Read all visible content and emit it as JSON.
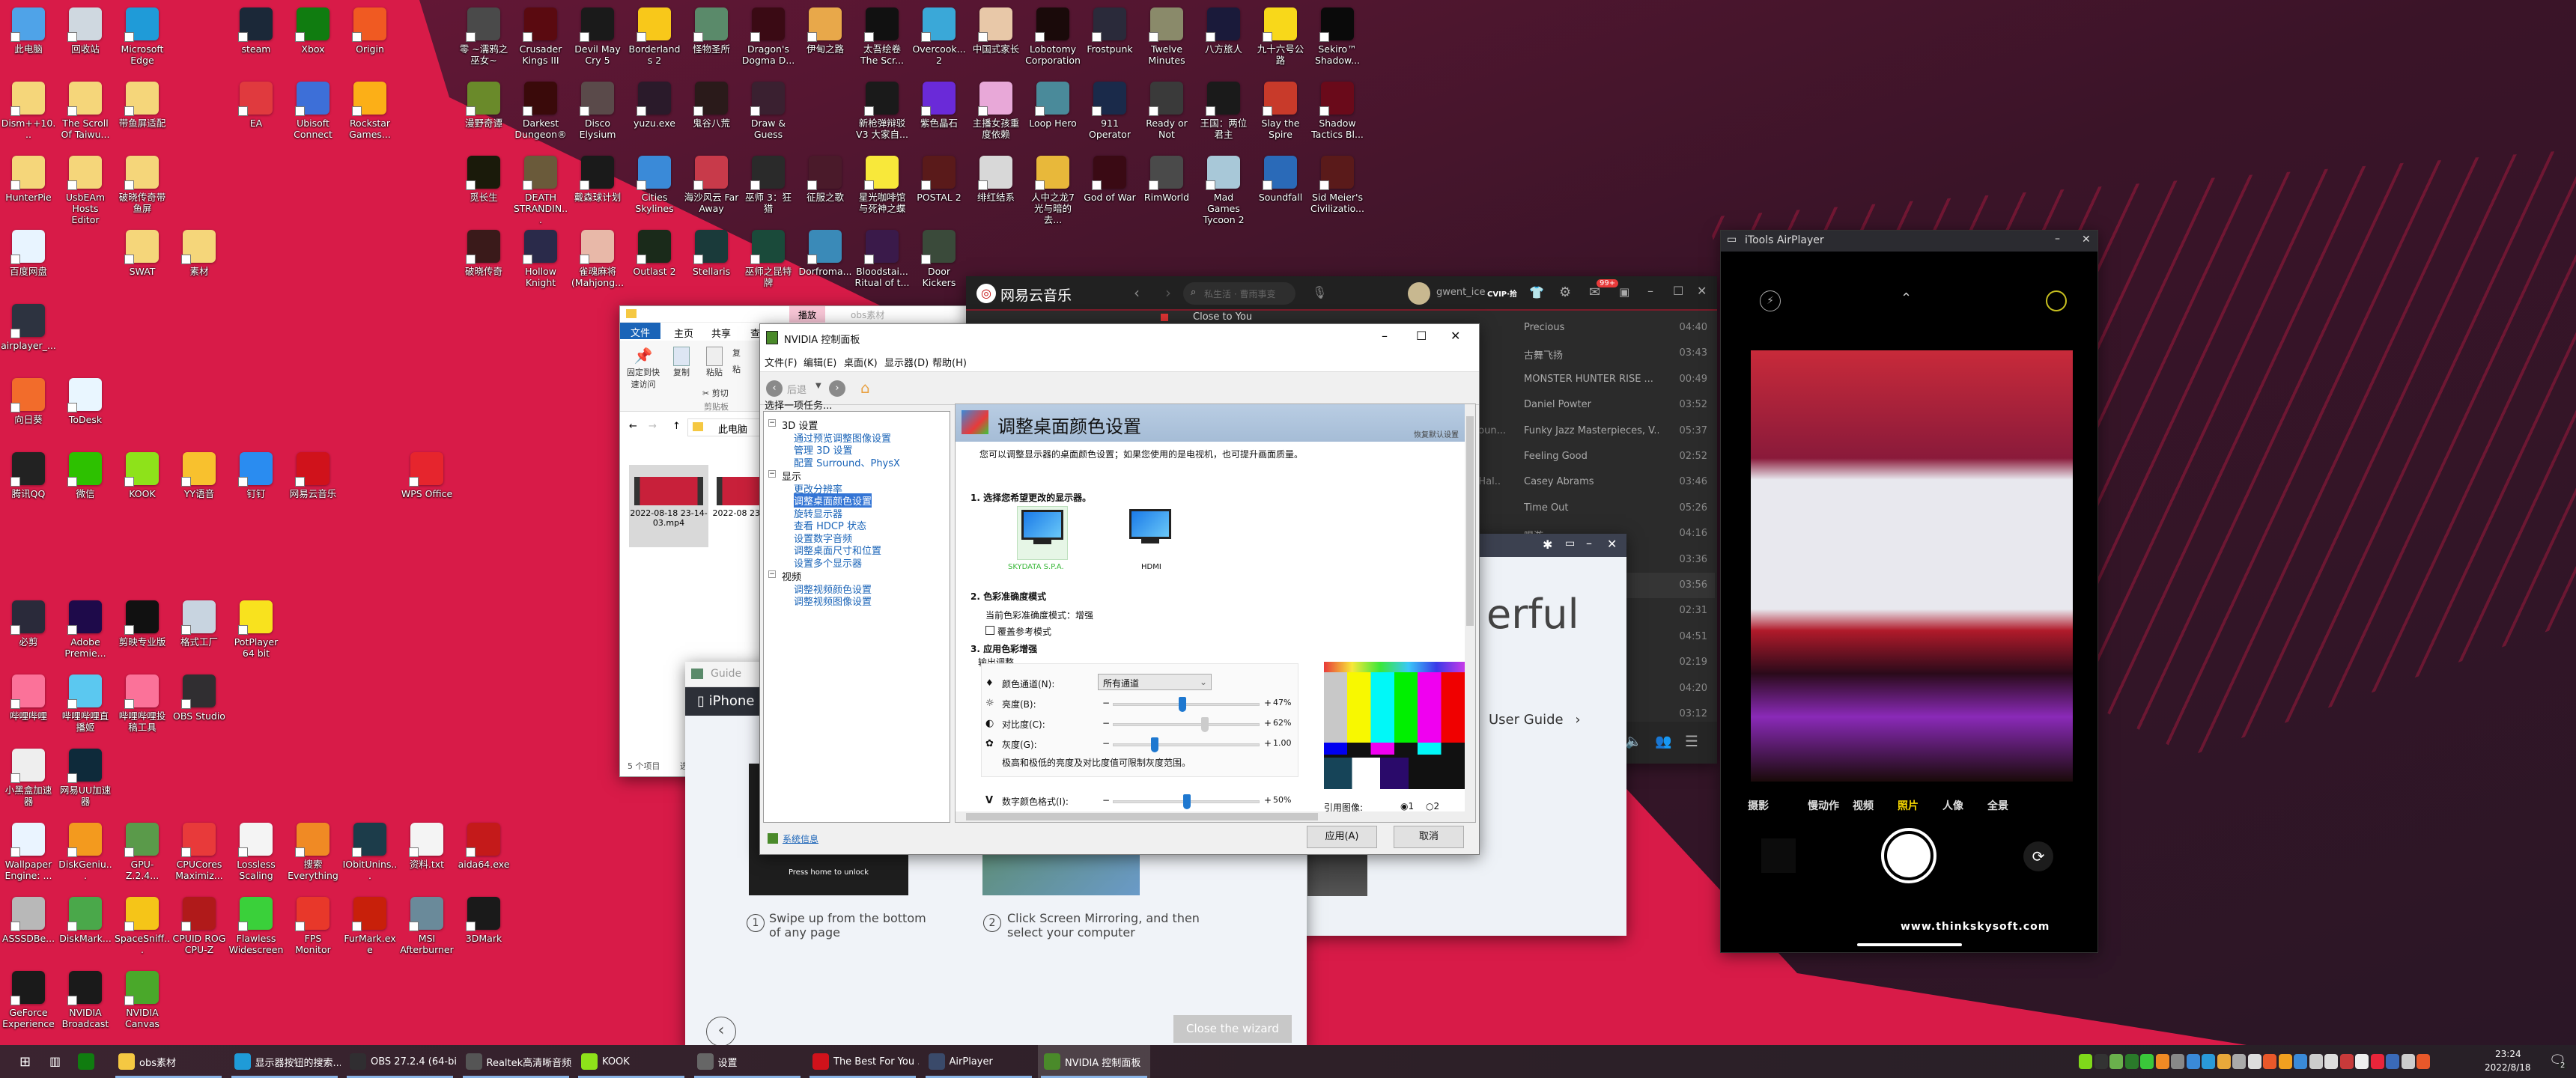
{
  "desktop": {
    "left_rows": [
      [
        {
          "label": "此电脑",
          "color": "#4fa3e8"
        },
        {
          "label": "回收站",
          "color": "#cfd8e0"
        },
        {
          "label": "Microsoft Edge",
          "color": "#1f9bd8"
        },
        null,
        {
          "label": "steam",
          "color": "#1b2838"
        },
        {
          "label": "Xbox",
          "color": "#107c10"
        },
        {
          "label": "Origin",
          "color": "#f05a22"
        }
      ],
      [
        {
          "label": "Dism++10...",
          "color": "#f5d67a"
        },
        {
          "label": "The Scroll Of Taiwu...",
          "color": "#f5d67a"
        },
        {
          "label": "带鱼屏适配",
          "color": "#f5d67a"
        },
        null,
        {
          "label": "EA",
          "color": "#e03a3e"
        },
        {
          "label": "Ubisoft Connect",
          "color": "#3d6fd8"
        },
        {
          "label": "Rockstar Games...",
          "color": "#fcaf17"
        }
      ],
      [
        {
          "label": "HunterPie",
          "color": "#f5d67a"
        },
        {
          "label": "UsbEAm Hosts Editor",
          "color": "#f5d67a"
        },
        {
          "label": "破晓传奇带鱼屏",
          "color": "#f5d67a"
        }
      ],
      [
        {
          "label": "百度网盘",
          "color": "#e8f4ff"
        },
        null,
        {
          "label": "SWAT",
          "color": "#f5d67a"
        },
        {
          "label": "素材",
          "color": "#f5d67a"
        }
      ],
      [
        {
          "label": "airplayer_...",
          "color": "#2d3340"
        }
      ],
      [
        {
          "label": "向日葵",
          "color": "#f26c2b"
        },
        {
          "label": "ToDesk",
          "color": "#e9f6ff"
        }
      ],
      [
        {
          "label": "腾讯QQ",
          "color": "#222"
        },
        {
          "label": "微信",
          "color": "#2dc100"
        },
        {
          "label": "KOOK",
          "color": "#8ee21a"
        },
        {
          "label": "YY语音",
          "color": "#f8c12e"
        },
        {
          "label": "钉钉",
          "color": "#2a8cf0"
        },
        {
          "label": "网易云音乐",
          "color": "#d0121b"
        },
        null,
        {
          "label": "WPS Office",
          "color": "#e6252d"
        }
      ],
      [],
      [
        {
          "label": "必剪",
          "color": "#2a2a3a"
        },
        {
          "label": "Adobe Premie...",
          "color": "#1e0a4a"
        },
        {
          "label": "剪映专业版",
          "color": "#111"
        },
        {
          "label": "格式工厂",
          "color": "#c8d4e0"
        },
        {
          "label": "PotPlayer 64 bit",
          "color": "#f8e21e"
        }
      ],
      [
        {
          "label": "哔哩哔哩",
          "color": "#fb7299"
        },
        {
          "label": "哔哩哔哩直播姬",
          "color": "#5bc8f0"
        },
        {
          "label": "哔哩哔哩投稿工具",
          "color": "#fb7299"
        },
        {
          "label": "OBS Studio",
          "color": "#302e31"
        }
      ],
      [
        {
          "label": "小黑盒加速器",
          "color": "#eeeeee"
        },
        {
          "label": "网易UU加速器",
          "color": "#0e2a3a"
        }
      ],
      [
        {
          "label": "Wallpaper Engine: ...",
          "color": "#eaf4ff"
        },
        {
          "label": "DiskGeniu...",
          "color": "#f39a1e"
        },
        {
          "label": "GPU-Z.2.4...",
          "color": "#5a9a4a"
        },
        {
          "label": "CPUCores Maximiz...",
          "color": "#e83a3a"
        },
        {
          "label": "Lossless Scaling",
          "color": "#f4f4f4"
        },
        {
          "label": "搜索 Everything",
          "color": "#f08a24"
        },
        {
          "label": "IObitUnins...",
          "color": "#1c3c4a"
        },
        {
          "label": "资料.txt",
          "color": "#f4f4f4"
        },
        {
          "label": "aida64.exe",
          "color": "#c41a1a"
        }
      ],
      [
        {
          "label": "ASSSDBe...",
          "color": "#b8b8b8"
        },
        {
          "label": "DiskMark...",
          "color": "#4aa84a"
        },
        {
          "label": "SpaceSniff...",
          "color": "#f5c518"
        },
        {
          "label": "CPUID ROG CPU-Z",
          "color": "#b01a1a"
        },
        {
          "label": "Flawless Widescreen",
          "color": "#3ad03a"
        },
        {
          "label": "FPS Monitor",
          "color": "#e8382a"
        },
        {
          "label": "FurMark.exe",
          "color": "#c8200a"
        },
        {
          "label": "MSI Afterburner",
          "color": "#6a8a9a"
        },
        {
          "label": "3DMark",
          "color": "#1a1a1a"
        }
      ],
      [
        {
          "label": "GeForce Experience",
          "color": "#1a1a1a"
        },
        {
          "label": "NVIDIA Broadcast",
          "color": "#1a1a1a"
        },
        {
          "label": "NVIDIA Canvas",
          "color": "#4aa82a"
        }
      ]
    ],
    "game_rows": [
      [
        {
          "label": "零 ~濡鸦之巫女~",
          "color": "#4a4a4a"
        },
        {
          "label": "Crusader Kings III",
          "color": "#5a0a10"
        },
        {
          "label": "Devil May Cry 5",
          "color": "#1a1a1a"
        },
        {
          "label": "Borderlands 2",
          "color": "#f8c81a"
        },
        {
          "label": "怪物圣所",
          "color": "#5a8a6a"
        },
        {
          "label": "Dragon's Dogma D...",
          "color": "#3a0a14"
        },
        {
          "label": "伊甸之路",
          "color": "#e8a84a"
        },
        {
          "label": "太吾绘卷 The Scr...",
          "color": "#111"
        },
        {
          "label": "Overcook... 2",
          "color": "#3aa8d8"
        },
        {
          "label": "中国式家长",
          "color": "#e8c8a8"
        },
        {
          "label": "Lobotomy Corporation",
          "color": "#1a0a0a"
        },
        {
          "label": "Frostpunk",
          "color": "#2a2a3a"
        },
        {
          "label": "Twelve Minutes",
          "color": "#8a8a6a"
        },
        {
          "label": "八方旅人",
          "color": "#1a1a3a"
        },
        {
          "label": "九十六号公路",
          "color": "#f8d81a"
        },
        {
          "label": "Sekiro™ Shadow...",
          "color": "#0a0a0a"
        }
      ],
      [
        {
          "label": "漫野奇谭",
          "color": "#6a8a2a"
        },
        {
          "label": "Darkest Dungeon®",
          "color": "#3a0a0a"
        },
        {
          "label": "Disco Elysium",
          "color": "#5a4a4a"
        },
        {
          "label": "yuzu.exe",
          "color": "#2a1a2a"
        },
        {
          "label": "鬼谷八荒",
          "color": "#2a1a1a"
        },
        {
          "label": "Draw & Guess",
          "color": "#3a2030"
        },
        null,
        {
          "label": "新枪弹辩驳 V3 大家自...",
          "color": "#1a1a1a"
        },
        {
          "label": "紫色晶石",
          "color": "#6a2ad8"
        },
        {
          "label": "主播女孩重度依赖",
          "color": "#e8a8d8"
        },
        {
          "label": "Loop Hero",
          "color": "#4a8a9a"
        },
        {
          "label": "911 Operator",
          "color": "#1a2a4a"
        },
        {
          "label": "Ready or Not",
          "color": "#3a3a3a"
        },
        {
          "label": "王国：两位君主",
          "color": "#1a1a1a"
        },
        {
          "label": "Slay the Spire",
          "color": "#c83a2a"
        },
        {
          "label": "Shadow Tactics Bl...",
          "color": "#6a0a1a"
        }
      ],
      [
        {
          "label": "觅长生",
          "color": "#1a1a0a"
        },
        {
          "label": "DEATH STRANDIN...",
          "color": "#6a5a3a"
        },
        {
          "label": "戴森球计划",
          "color": "#1a1a1a"
        },
        {
          "label": "Cities Skylines",
          "color": "#3a8ad8"
        },
        {
          "label": "海沙风云 Far Away",
          "color": "#c83a4a"
        },
        {
          "label": "巫师 3：狂猎",
          "color": "#2a2a2a"
        },
        {
          "label": "征服之歌",
          "color": "#4a1a2a"
        },
        {
          "label": "星光咖啡馆与死神之蝶",
          "color": "#f8e83a"
        },
        {
          "label": "POSTAL 2",
          "color": "#5a1a1a"
        },
        {
          "label": "绯红结系",
          "color": "#d8d8d8"
        },
        {
          "label": "人中之龙7 光与暗的去...",
          "color": "#e8b83a"
        },
        {
          "label": "God of War",
          "color": "#3a0a14"
        },
        {
          "label": "RimWorld",
          "color": "#4a4a4a"
        },
        {
          "label": "Mad Games Tycoon 2",
          "color": "#a8c8d8"
        },
        {
          "label": "Soundfall",
          "color": "#2a6ab8"
        },
        {
          "label": "Sid Meier's Civilizatio...",
          "color": "#5a1a1a"
        }
      ],
      [
        {
          "label": "破晓传奇",
          "color": "#3a1a1a"
        },
        {
          "label": "Hollow Knight",
          "color": "#2a2a4a"
        },
        {
          "label": "雀魂麻将(Mahjong...",
          "color": "#e8b8a8"
        },
        {
          "label": "Outlast 2",
          "color": "#1a2a1a"
        },
        {
          "label": "Stellaris",
          "color": "#1a3a3a"
        },
        {
          "label": "巫师之昆特牌",
          "color": "#1a4a3a"
        },
        {
          "label": "Dorfroma...",
          "color": "#3a8ab8"
        },
        {
          "label": "Bloodstai... Ritual of t...",
          "color": "#3a1a4a"
        },
        {
          "label": "Door Kickers",
          "color": "#3a4a3a"
        }
      ]
    ]
  },
  "explorer": {
    "title": "obs素材",
    "context_tab": "播放",
    "tabs": [
      "文件",
      "主页",
      "共享",
      "查"
    ],
    "ribbon": {
      "pin": "固定到快速访问",
      "copy": "复制",
      "paste": "粘贴",
      "cut": "剪切",
      "clipboard": "剪贴板",
      "copy_path": "复",
      "paste_shortcut": "粘"
    },
    "address": "此电脑",
    "files": [
      {
        "name": "2022-08-18 23-14-03.mp4"
      },
      {
        "name": "2022-08 23-19-17."
      }
    ],
    "status": "5 个项目",
    "status_extra": "选"
  },
  "guide": {
    "title": "Guide",
    "device_tab": "iPhone",
    "lock_text": "Press home to unlock",
    "steps": [
      {
        "num": "1",
        "text": "Swipe up from the bottom of any page"
      },
      {
        "num": "2",
        "text": "Click Screen Mirroring, and then select your computer"
      }
    ],
    "close_button": "Close the wizard"
  },
  "guide2": {
    "headline": "erful",
    "user_guide": "User Guide"
  },
  "music": {
    "app_name": "网易云音乐",
    "search_placeholder": "私生活 · 曹雨事变",
    "username": "gwent_ice",
    "vip_badge": "CVIP·拾",
    "mail_badge": "99+",
    "now_playing": "Close to You",
    "songs": [
      {
        "title": "Precious",
        "duration": "04:40",
        "extra": ""
      },
      {
        "title": "古舞飞扬",
        "duration": "03:43",
        "extra": ""
      },
      {
        "title": "MONSTER HUNTER RISE ...",
        "duration": "00:49",
        "extra": ""
      },
      {
        "title": "Daniel Powter",
        "duration": "03:52",
        "extra": ""
      },
      {
        "title": "Funky Jazz Masterpieces, V...",
        "duration": "05:37",
        "extra": "e Loun..."
      },
      {
        "title": "Feeling Good",
        "duration": "02:52",
        "extra": ""
      },
      {
        "title": "Casey Abrams",
        "duration": "03:46",
        "extra": "s / Hal.."
      },
      {
        "title": "Time Out",
        "duration": "05:26",
        "extra": ""
      },
      {
        "title": "唱游",
        "duration": "04:16",
        "extra": ""
      },
      {
        "title": "",
        "duration": "03:36",
        "extra": ""
      },
      {
        "title": "",
        "duration": "03:56",
        "extra": ""
      },
      {
        "title": "",
        "duration": "02:31",
        "extra": ""
      },
      {
        "title": "",
        "duration": "04:51",
        "extra": ""
      },
      {
        "title": "",
        "duration": "02:19",
        "extra": "ng"
      },
      {
        "title": "",
        "duration": "04:20",
        "extra": "oy 里..."
      },
      {
        "title": "",
        "duration": "03:12",
        "extra": ""
      }
    ],
    "highlight_index": 10
  },
  "nvidia": {
    "title": "NVIDIA 控制面板",
    "menu": [
      "文件(F)",
      "编辑(E)",
      "桌面(K)",
      "显示器(D)",
      "帮助(H)"
    ],
    "back_label": "后退",
    "task_prompt": "选择一项任务...",
    "tree": [
      {
        "label": "3D 设置",
        "type": "group"
      },
      {
        "label": "通过预览调整图像设置",
        "type": "link"
      },
      {
        "label": "管理 3D 设置",
        "type": "link"
      },
      {
        "label": "配置 Surround、PhysX",
        "type": "link"
      },
      {
        "label": "显示",
        "type": "group"
      },
      {
        "label": "更改分辨率",
        "type": "link"
      },
      {
        "label": "调整桌面颜色设置",
        "type": "selected"
      },
      {
        "label": "旋转显示器",
        "type": "link"
      },
      {
        "label": "查看 HDCP 状态",
        "type": "link"
      },
      {
        "label": "设置数字音频",
        "type": "link"
      },
      {
        "label": "调整桌面尺寸和位置",
        "type": "link"
      },
      {
        "label": "设置多个显示器",
        "type": "link"
      },
      {
        "label": "视频",
        "type": "group"
      },
      {
        "label": "调整视频颜色设置",
        "type": "link"
      },
      {
        "label": "调整视频图像设置",
        "type": "link"
      }
    ],
    "page_title": "调整桌面颜色设置",
    "restore_defaults": "恢复默认设置",
    "description": "您可以调整显示器的桌面颜色设置；如果您使用的是电视机，也可提升画面质量。",
    "section1": "1. 选择您希望更改的显示器。",
    "displays": [
      {
        "label": "SKYDATA S.P.A.",
        "selected": true
      },
      {
        "label": "HDMI",
        "selected": false
      }
    ],
    "section2": "2. 色彩准确度模式",
    "accuracy_mode": "当前色彩准确度模式：增强",
    "override_checkbox": "覆盖参考模式",
    "override_checked": false,
    "section3": "3. 应用色彩增强",
    "output_group": "输出调整",
    "channel_label": "颜色通道(N):",
    "channel_value": "所有通道",
    "sliders": [
      {
        "label": "亮度(B):",
        "value_text": "47%",
        "value": 47,
        "min": 0,
        "max": 100,
        "icon": "sun-icon"
      },
      {
        "label": "对比度(C):",
        "value_text": "62%",
        "value": 62,
        "min": 0,
        "max": 100,
        "icon": "contrast-icon"
      },
      {
        "label": "灰度(G):",
        "value_text": "1.00",
        "value": 1.0,
        "min": 0.3,
        "max": 2.8,
        "icon": "gamma-icon"
      }
    ],
    "range_note": "极高和极低的亮度及对比度值可限制灰度范围。",
    "vibrance": {
      "label": "数字颜色格式(I):",
      "value_text": "50%",
      "value": 50,
      "min": 0,
      "max": 100
    },
    "reference_label": "引用图像:",
    "reference_options": [
      "1",
      "2"
    ],
    "reference_selected": "1",
    "system_info": "系统信息",
    "apply": "应用(A)",
    "cancel": "取消"
  },
  "airplayer": {
    "title": "iTools AirPlayer",
    "modes": [
      "摄影",
      "慢动作",
      "视频",
      "照片",
      "人像",
      "全景"
    ],
    "active_mode": "照片",
    "watermark": "www.thinkskysoft.com"
  },
  "taskbar": {
    "items": [
      {
        "label": "obs素材",
        "icon": "folder-icon",
        "color": "#f5c842",
        "active": false
      },
      {
        "label": "显示器按钮的搜索...",
        "icon": "edge-icon",
        "color": "#1f9bd8",
        "active": false
      },
      {
        "label": "OBS 27.2.4 (64-bi...",
        "icon": "obs-icon",
        "color": "#302e31",
        "active": false
      },
      {
        "label": "Realtek高清晰音频...",
        "icon": "realtek-icon",
        "color": "#555",
        "active": false
      },
      {
        "label": "KOOK",
        "icon": "kook-icon",
        "color": "#8ee21a",
        "active": false
      },
      {
        "label": "设置",
        "icon": "gear-icon",
        "color": "#666",
        "active": false
      },
      {
        "label": "The Best For You ...",
        "icon": "netease-music-icon",
        "color": "#d0121b",
        "active": false
      },
      {
        "label": "AirPlayer",
        "icon": "airplayer-icon",
        "color": "#3a4a6a",
        "active": false
      },
      {
        "label": "NVIDIA 控制面板",
        "icon": "nvidia-icon",
        "color": "#4a8a2a",
        "active": true
      }
    ],
    "tray_colors": [
      "#7fd81a",
      "#333",
      "#6ab04c",
      "#2a7a2a",
      "#3ac83a",
      "#f08a24",
      "#888",
      "#3a8ad8",
      "#2a9ad8",
      "#e8a83a",
      "#aaa",
      "#ddd",
      "#e8582a",
      "#f0a020",
      "#3a8ad8",
      "#ccc",
      "#ddd",
      "#c83a3a",
      "#eee",
      "#e8253a",
      "#3a6ab8",
      "#ccc",
      "#e8582a"
    ],
    "time": "23:24",
    "date": "2022/8/18",
    "notification_count": "2"
  }
}
